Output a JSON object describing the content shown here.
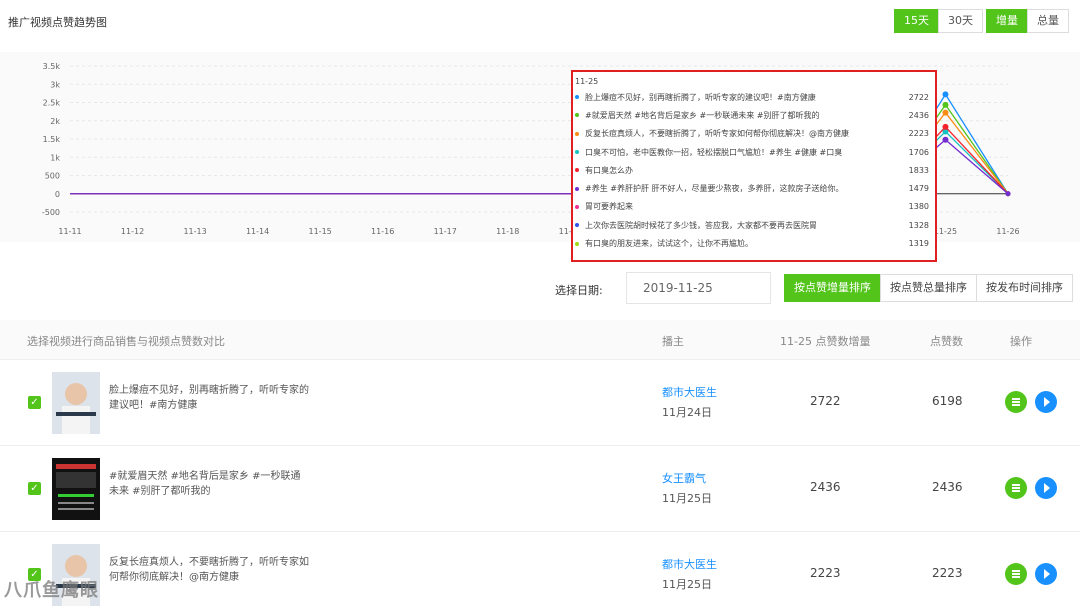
{
  "header": {
    "title": "推广视频点赞趋势图",
    "range_15": "15天",
    "range_30": "30天",
    "mode_inc": "增量",
    "mode_total": "总量"
  },
  "chart_data": {
    "type": "line",
    "x": [
      "11-11",
      "11-12",
      "11-13",
      "11-14",
      "11-15",
      "11-16",
      "11-17",
      "11-18",
      "11-19",
      "11-20",
      "11-21",
      "11-22",
      "11-23",
      "11-24",
      "11-25",
      "11-26"
    ],
    "y_ticks": [
      "3.5k",
      "3k",
      "2.5k",
      "2k",
      "1.5k",
      "1k",
      "500",
      "0",
      "-500"
    ],
    "ylim": [
      -500,
      3500
    ],
    "series": [
      {
        "color": "#1890ff",
        "values": [
          0,
          0,
          0,
          0,
          0,
          0,
          0,
          0,
          0,
          0,
          0,
          0,
          0,
          0,
          2722,
          0
        ]
      },
      {
        "color": "#52c41a",
        "values": [
          0,
          0,
          0,
          0,
          0,
          0,
          0,
          0,
          0,
          0,
          0,
          0,
          0,
          0,
          2436,
          0
        ]
      },
      {
        "color": "#fa8c16",
        "values": [
          0,
          0,
          0,
          0,
          0,
          0,
          0,
          0,
          0,
          0,
          0,
          0,
          0,
          0,
          2223,
          0
        ]
      },
      {
        "color": "#13c2c2",
        "values": [
          0,
          0,
          0,
          0,
          0,
          0,
          0,
          0,
          0,
          0,
          0,
          0,
          0,
          0,
          1706,
          0
        ]
      },
      {
        "color": "#f5222d",
        "values": [
          0,
          0,
          0,
          0,
          0,
          0,
          0,
          0,
          0,
          0,
          0,
          0,
          0,
          0,
          1833,
          0
        ]
      },
      {
        "color": "#722ed1",
        "values": [
          0,
          0,
          0,
          0,
          0,
          0,
          0,
          0,
          0,
          0,
          0,
          0,
          0,
          0,
          1479,
          0
        ]
      }
    ]
  },
  "tooltip": {
    "date": "11-25",
    "rows": [
      {
        "color": "#1890ff",
        "text": "脸上爆痘不见好，别再瞎折腾了，听听专家的建议吧！#南方健康",
        "value": "2722"
      },
      {
        "color": "#52c41a",
        "text": "#就爱眉天然 #地名背后是家乡 #一秒联通未来 #别肝了都听我的",
        "value": "2436"
      },
      {
        "color": "#fa8c16",
        "text": "反复长痘真烦人，不要瞎折腾了，听听专家如何帮你彻底解决！@南方健康",
        "value": "2223"
      },
      {
        "color": "#13c2c2",
        "text": "口臭不可怕，老中医教你一招，轻松摆脱口气尴尬！#养生 #健康 #口臭",
        "value": "1706"
      },
      {
        "color": "#f5222d",
        "text": "有口臭怎么办",
        "value": "1833"
      },
      {
        "color": "#722ed1",
        "text": "#养生 #养肝护肝 肝不好人，尽量要少熬夜，多养肝，这款房子送给你。",
        "value": "1479"
      },
      {
        "color": "#eb2f96",
        "text": "胃可要养起来",
        "value": "1380"
      },
      {
        "color": "#2f54eb",
        "text": "上次你去医院胡时候花了多少钱，答应我，大家都不要再去医院胃",
        "value": "1328"
      },
      {
        "color": "#a0d911",
        "text": "有口臭的朋友进来，试试这个，让你不再尴尬。",
        "value": "1319"
      }
    ]
  },
  "filter": {
    "date_label": "选择日期:",
    "date_value": "2019-11-25",
    "sort_inc": "按点赞增量排序",
    "sort_total": "按点赞总量排序",
    "sort_time": "按发布时间排序"
  },
  "table": {
    "col_select": "选择视频进行商品销售与视频点赞数对比",
    "col_author": "播主",
    "col_inc": "11-25 点赞数增量",
    "col_total": "点赞数",
    "col_op": "操作",
    "rows": [
      {
        "title": "脸上爆痘不见好，别再瞎折腾了，听听专家的建议吧！#南方健康",
        "author": "都市大医生",
        "date": "11月24日",
        "inc": "2722",
        "total": "6198"
      },
      {
        "title": "#就爱眉天然 #地名背后是家乡 #一秒联通未来 #别肝了都听我的",
        "author": "女王霸气",
        "date": "11月25日",
        "inc": "2436",
        "total": "2436"
      },
      {
        "title": "反复长痘真烦人，不要瞎折腾了，听听专家如何帮你彻底解决！@南方健康",
        "author": "都市大医生",
        "date": "11月25日",
        "inc": "2223",
        "total": "2223"
      }
    ]
  },
  "watermark": "八爪鱼鹰眼"
}
